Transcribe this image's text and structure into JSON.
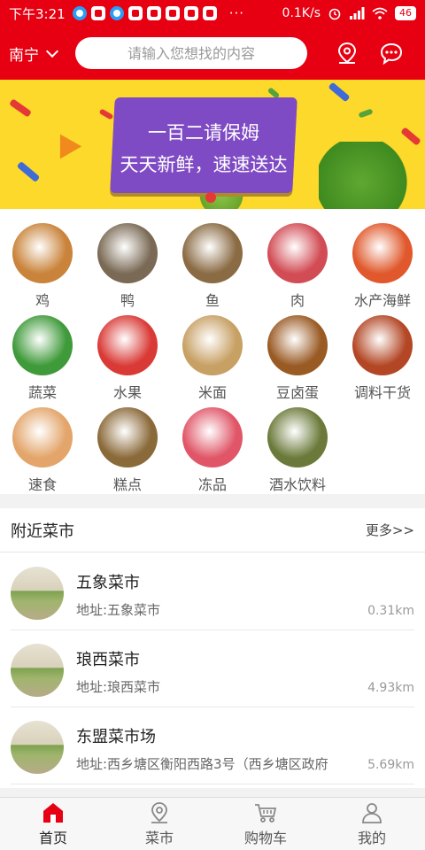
{
  "status_bar": {
    "time": "下午3:21",
    "more": "···",
    "net_speed": "0.1K/s",
    "battery": "46",
    "app_icons": [
      "browser-icon",
      "mail-icon",
      "checklist-icon",
      "app-icon",
      "app-icon",
      "app-icon",
      "app-icon",
      "app-icon"
    ]
  },
  "header": {
    "city": "南宁",
    "search_placeholder": "请输入您想找的内容",
    "location_icon": "location-pin-icon",
    "message_icon": "chat-bubble-icon"
  },
  "banner": {
    "line1": "一百二请保姆",
    "line2": "天天新鲜，速速送达"
  },
  "categories": [
    {
      "label": "鸡",
      "color": "#c9833a"
    },
    {
      "label": "鸭",
      "color": "#7a6a55"
    },
    {
      "label": "鱼",
      "color": "#8a6b44"
    },
    {
      "label": "肉",
      "color": "#d24c55"
    },
    {
      "label": "水产海鲜",
      "color": "#e0582b"
    },
    {
      "label": "蔬菜",
      "color": "#3f9a3a"
    },
    {
      "label": "水果",
      "color": "#d93a36"
    },
    {
      "label": "米面",
      "color": "#c7a064"
    },
    {
      "label": "豆卤蛋",
      "color": "#9a5a24"
    },
    {
      "label": "调料干货",
      "color": "#b34725"
    },
    {
      "label": "速食",
      "color": "#e3a56a"
    },
    {
      "label": "糕点",
      "color": "#8b6a3a"
    },
    {
      "label": "冻品",
      "color": "#e05668"
    },
    {
      "label": "酒水饮料",
      "color": "#6b7a3a"
    }
  ],
  "nearby": {
    "title": "附近菜市",
    "more": "更多>>",
    "markets": [
      {
        "name": "五象菜市",
        "address": "地址:五象菜市",
        "distance": "0.31km"
      },
      {
        "name": "琅西菜市",
        "address": "地址:琅西菜市",
        "distance": "4.93km"
      },
      {
        "name": "东盟菜市场",
        "address": "地址:西乡塘区衡阳西路3号（西乡塘区政府",
        "distance": "5.69km"
      }
    ]
  },
  "tabbar": {
    "active": "首页",
    "accent": "#e60012",
    "tabs": [
      {
        "label": "首页",
        "icon": "home-icon"
      },
      {
        "label": "菜市",
        "icon": "location-pin-icon"
      },
      {
        "label": "购物车",
        "icon": "cart-icon"
      },
      {
        "label": "我的",
        "icon": "user-icon"
      }
    ]
  }
}
